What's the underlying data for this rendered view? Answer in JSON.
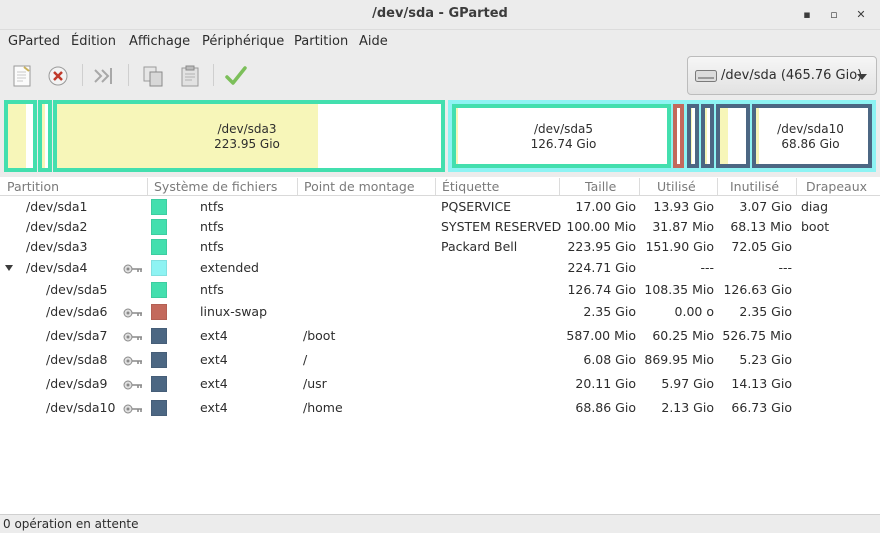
{
  "window": {
    "title": "/dev/sda - GParted",
    "minimize": "▪",
    "maximize": "▫",
    "close": "✕"
  },
  "menu": [
    "GParted",
    "Édition",
    "Affichage",
    "Périphérique",
    "Partition",
    "Aide"
  ],
  "toolbar": {
    "icons": [
      "new-icon",
      "delete-icon",
      "resize-icon",
      "copy-icon",
      "paste-icon",
      "apply-icon"
    ]
  },
  "device_selector": {
    "label": "/dev/sda  (465.76 Gio)",
    "icon": "harddisk-icon"
  },
  "disk_map": {
    "sda3": {
      "name": "/dev/sda3",
      "size": "223.95 Gio",
      "used_fraction": 0.68
    },
    "sda5": {
      "name": "/dev/sda5",
      "size": "126.74 Gio",
      "used_fraction": 0.01
    },
    "sda10": {
      "name": "/dev/sda10",
      "size": "68.86 Gio",
      "used_fraction": 0.03
    }
  },
  "columns": [
    "Partition",
    "Système de fichiers",
    "Point de montage",
    "Étiquette",
    "Taille",
    "Utilisé",
    "Inutilisé",
    "Drapeaux"
  ],
  "rows": [
    {
      "partition": "/dev/sda1",
      "fs": "ntfs",
      "mount": "",
      "label": "PQSERVICE",
      "size": "17.00 Gio",
      "used": "13.93 Gio",
      "unused": "3.07 Gio",
      "flags": "diag",
      "color": "#43dfae",
      "key": false,
      "indent": false
    },
    {
      "partition": "/dev/sda2",
      "fs": "ntfs",
      "mount": "",
      "label": "SYSTEM RESERVED",
      "size": "100.00 Mio",
      "used": "31.87 Mio",
      "unused": "68.13 Mio",
      "flags": "boot",
      "color": "#43dfae",
      "key": false,
      "indent": false
    },
    {
      "partition": "/dev/sda3",
      "fs": "ntfs",
      "mount": "",
      "label": "Packard Bell",
      "size": "223.95 Gio",
      "used": "151.90 Gio",
      "unused": "72.05 Gio",
      "flags": "",
      "color": "#43dfae",
      "key": false,
      "indent": false
    },
    {
      "partition": "/dev/sda4",
      "fs": "extended",
      "mount": "",
      "label": "",
      "size": "224.71 Gio",
      "used": "---",
      "unused": "---",
      "flags": "",
      "color": "#8ef3f3",
      "key": true,
      "indent": false,
      "expander": true
    },
    {
      "partition": "/dev/sda5",
      "fs": "ntfs",
      "mount": "",
      "label": "",
      "size": "126.74 Gio",
      "used": "108.35 Mio",
      "unused": "126.63 Gio",
      "flags": "",
      "color": "#43dfae",
      "key": false,
      "indent": true
    },
    {
      "partition": "/dev/sda6",
      "fs": "linux-swap",
      "mount": "",
      "label": "",
      "size": "2.35 Gio",
      "used": "0.00 o",
      "unused": "2.35 Gio",
      "flags": "",
      "color": "#c3695c",
      "key": true,
      "indent": true
    },
    {
      "partition": "/dev/sda7",
      "fs": "ext4",
      "mount": "/boot",
      "label": "",
      "size": "587.00 Mio",
      "used": "60.25 Mio",
      "unused": "526.75 Mio",
      "flags": "",
      "color": "#4c6783",
      "key": true,
      "indent": true
    },
    {
      "partition": "/dev/sda8",
      "fs": "ext4",
      "mount": "/",
      "label": "",
      "size": "6.08 Gio",
      "used": "869.95 Mio",
      "unused": "5.23 Gio",
      "flags": "",
      "color": "#4c6783",
      "key": true,
      "indent": true
    },
    {
      "partition": "/dev/sda9",
      "fs": "ext4",
      "mount": "/usr",
      "label": "",
      "size": "20.11 Gio",
      "used": "5.97 Gio",
      "unused": "14.13 Gio",
      "flags": "",
      "color": "#4c6783",
      "key": true,
      "indent": true
    },
    {
      "partition": "/dev/sda10",
      "fs": "ext4",
      "mount": "/home",
      "label": "",
      "size": "68.86 Gio",
      "used": "2.13 Gio",
      "unused": "66.73 Gio",
      "flags": "",
      "color": "#4c6783",
      "key": true,
      "indent": true
    }
  ],
  "status": "0 opération en attente"
}
